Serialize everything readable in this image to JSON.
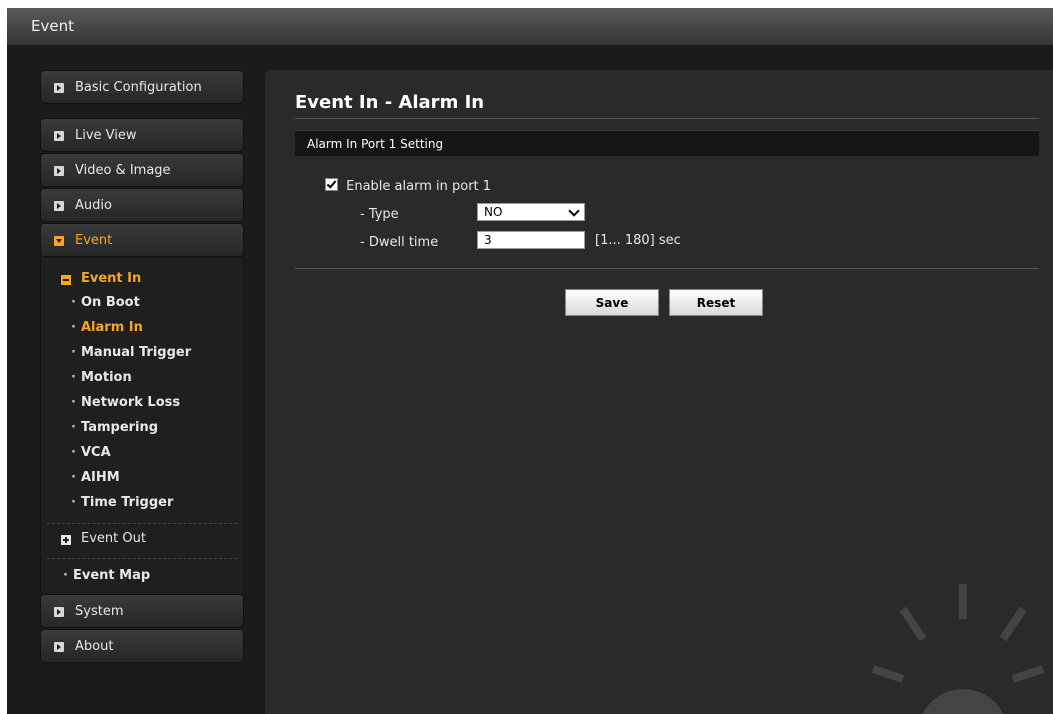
{
  "window": {
    "title": "Event"
  },
  "sidebar": {
    "top_items": [
      {
        "label": "Basic Configuration"
      }
    ],
    "items": [
      {
        "label": "Live View"
      },
      {
        "label": "Video & Image"
      },
      {
        "label": "Audio"
      },
      {
        "label": "Event"
      }
    ],
    "event_sub": {
      "event_in_label": "Event In",
      "event_in_items": [
        {
          "label": "On Boot"
        },
        {
          "label": "Alarm In"
        },
        {
          "label": "Manual Trigger"
        },
        {
          "label": "Motion"
        },
        {
          "label": "Network Loss"
        },
        {
          "label": "Tampering"
        },
        {
          "label": "VCA"
        },
        {
          "label": "AIHM"
        },
        {
          "label": "Time Trigger"
        }
      ],
      "event_out_label": "Event Out",
      "event_map_label": "Event Map"
    },
    "bottom_items": [
      {
        "label": "System"
      },
      {
        "label": "About"
      }
    ]
  },
  "main": {
    "title": "Event In - Alarm In",
    "section": "Alarm In Port 1 Setting",
    "enable_label": "Enable alarm in port 1",
    "type_label": "- Type",
    "type_value": "NO",
    "dwell_label": "- Dwell time",
    "dwell_value": "3",
    "dwell_hint": "[1... 180] sec",
    "save_label": "Save",
    "reset_label": "Reset"
  },
  "colors": {
    "accent": "#f5a623",
    "background": "#1b1b1b",
    "panel": "#2a2a2a"
  }
}
